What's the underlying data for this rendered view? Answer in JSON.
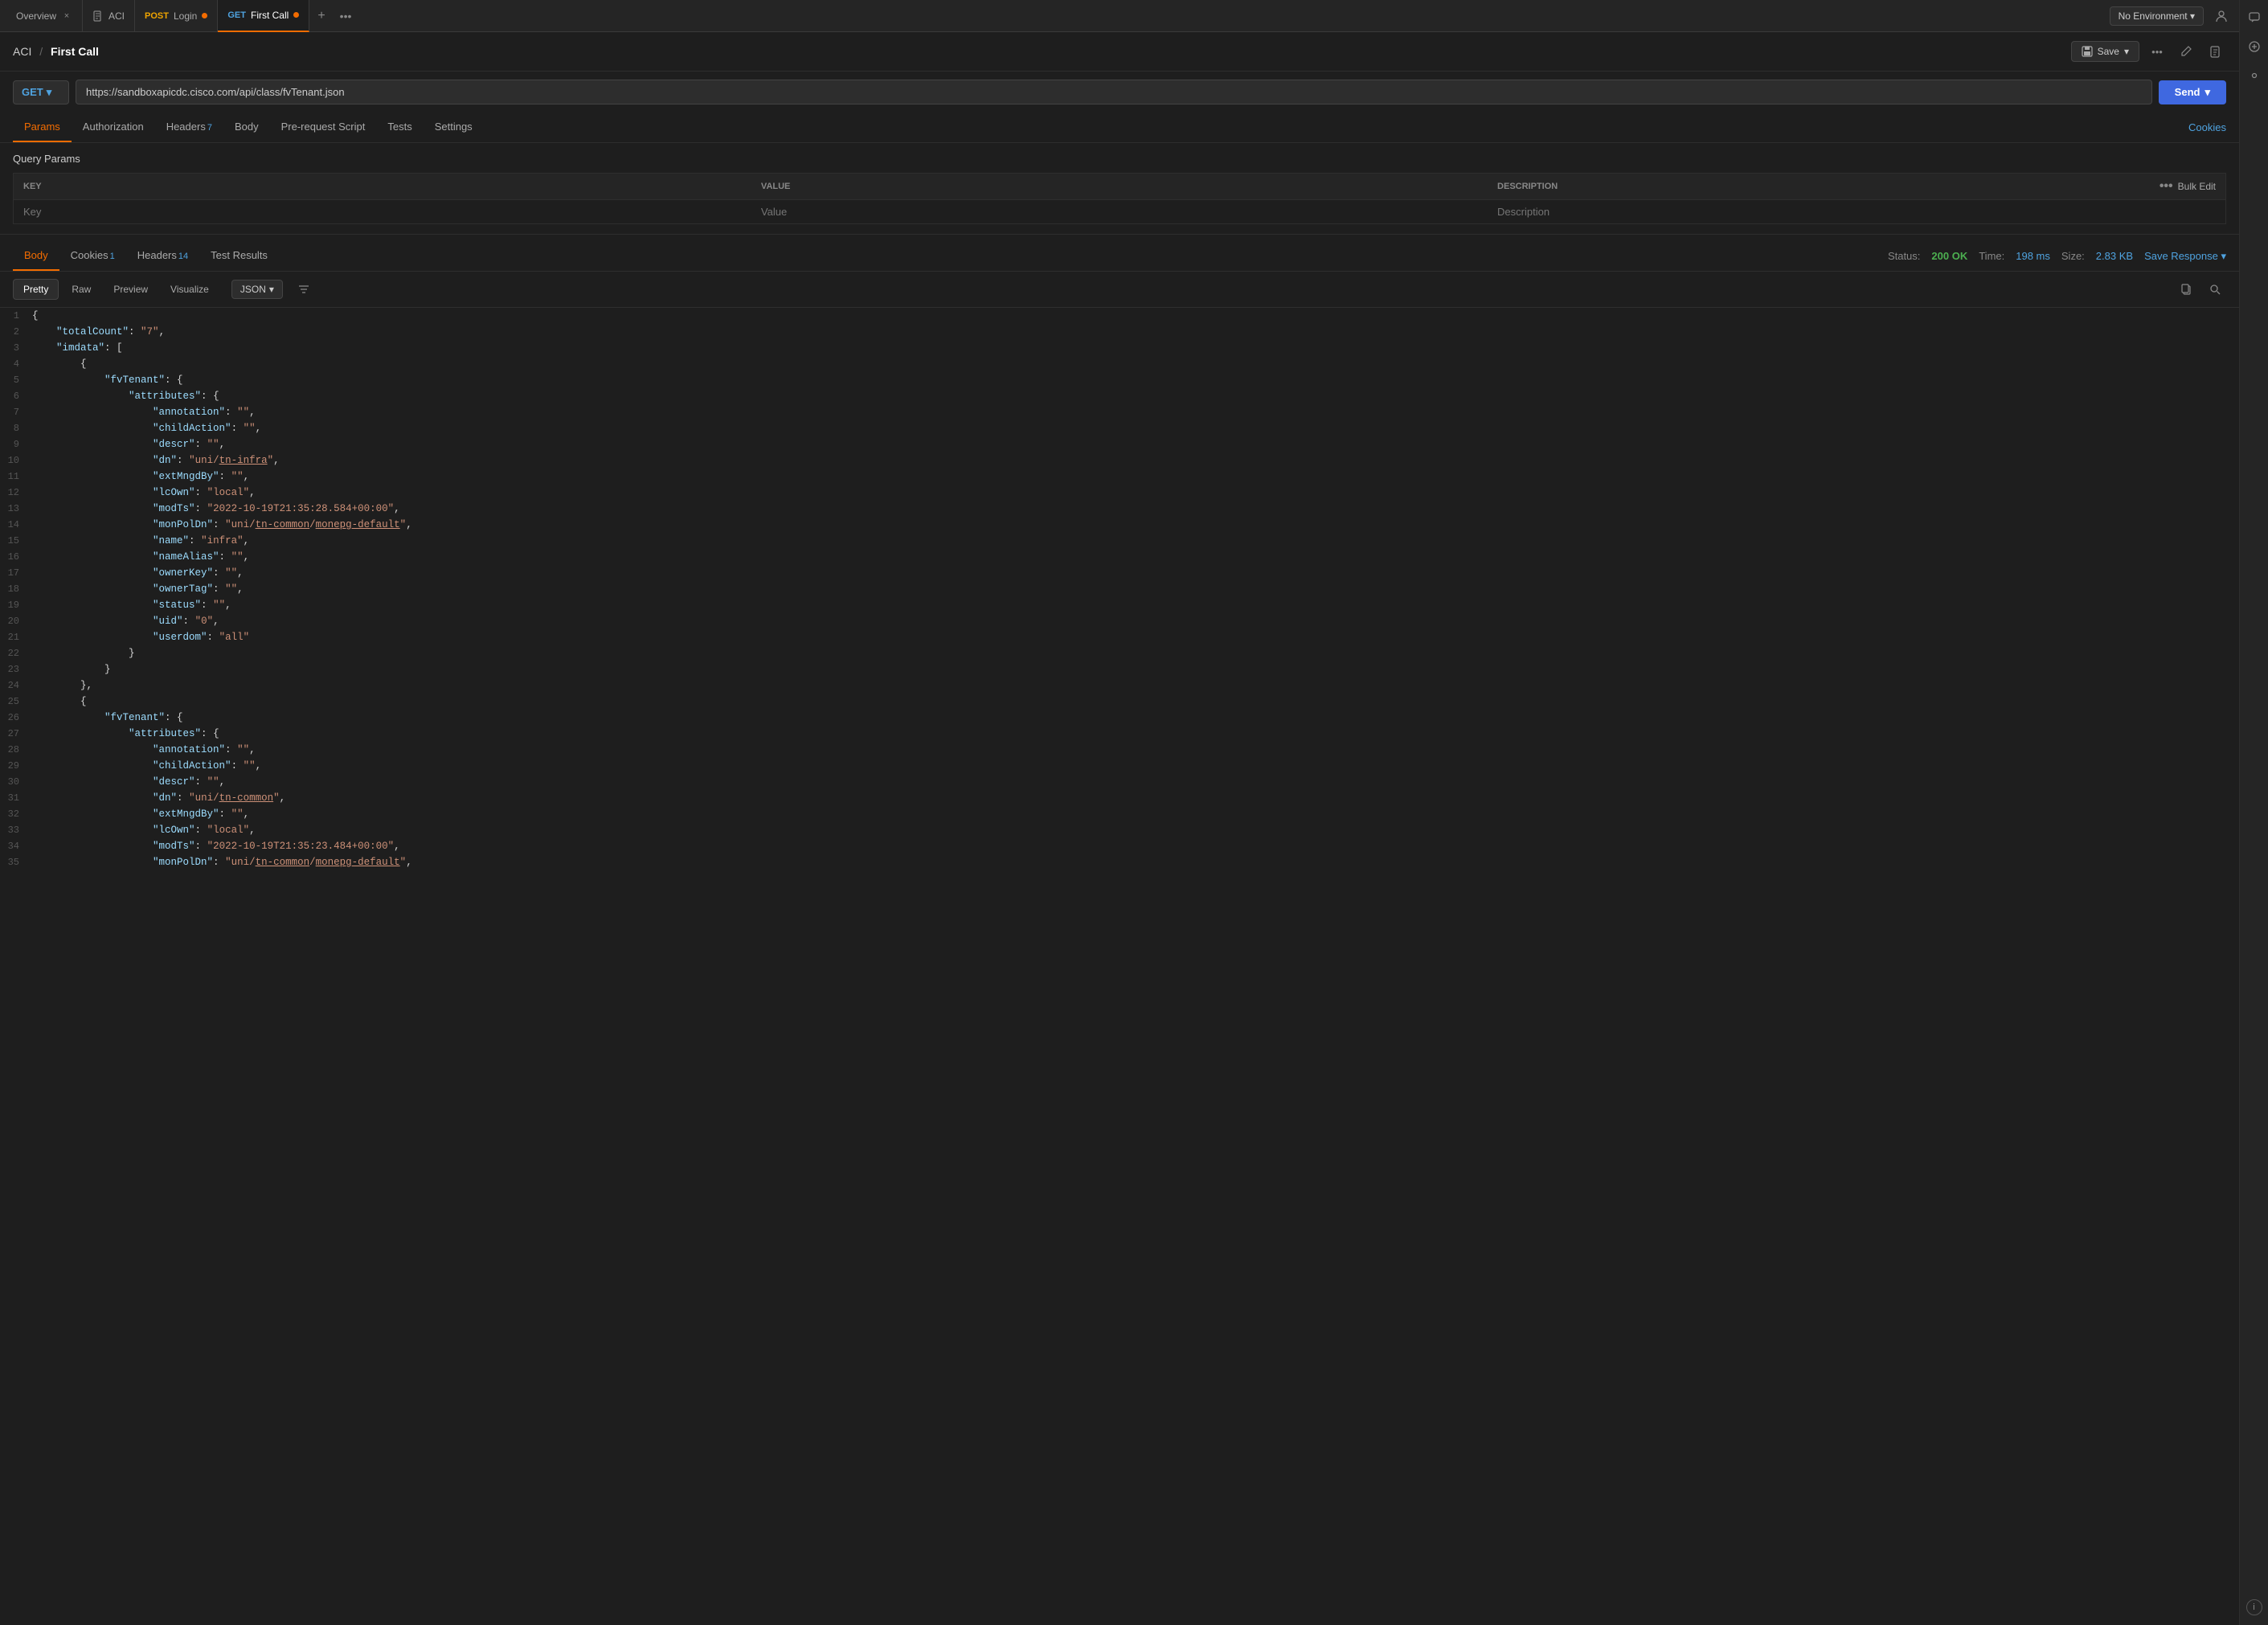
{
  "tabs": [
    {
      "id": "overview",
      "label": "Overview",
      "closable": true,
      "method": null,
      "dot": false
    },
    {
      "id": "aci",
      "label": "ACI",
      "closable": false,
      "method": null,
      "dot": false
    },
    {
      "id": "post-login",
      "label": "Login",
      "closable": false,
      "method": "POST",
      "dot": false
    },
    {
      "id": "get-first-call",
      "label": "First Call",
      "closable": false,
      "method": "GET",
      "dot": true,
      "active": true
    }
  ],
  "environment": {
    "label": "No Environment",
    "chevron": "▾"
  },
  "breadcrumb": {
    "parent": "ACI",
    "separator": "/",
    "current": "First Call"
  },
  "toolbar": {
    "save_label": "Save",
    "more_label": "•••"
  },
  "request": {
    "method": "GET",
    "url": "https://sandboxapicdc.cisco.com/api/class/fvTenant.json",
    "send_label": "Send"
  },
  "req_tabs": [
    {
      "id": "params",
      "label": "Params",
      "active": true,
      "badge": null
    },
    {
      "id": "authorization",
      "label": "Authorization",
      "active": false,
      "badge": null
    },
    {
      "id": "headers",
      "label": "Headers",
      "active": false,
      "badge": "7"
    },
    {
      "id": "body",
      "label": "Body",
      "active": false,
      "badge": null
    },
    {
      "id": "pre-request-script",
      "label": "Pre-request Script",
      "active": false,
      "badge": null
    },
    {
      "id": "tests",
      "label": "Tests",
      "active": false,
      "badge": null
    },
    {
      "id": "settings",
      "label": "Settings",
      "active": false,
      "badge": null
    }
  ],
  "cookies_label": "Cookies",
  "params": {
    "title": "Query Params",
    "columns": [
      "KEY",
      "VALUE",
      "DESCRIPTION"
    ],
    "bulk_edit_label": "Bulk Edit",
    "placeholder_key": "Key",
    "placeholder_value": "Value",
    "placeholder_desc": "Description"
  },
  "resp_tabs": [
    {
      "id": "body",
      "label": "Body",
      "active": true,
      "badge": null
    },
    {
      "id": "cookies",
      "label": "Cookies",
      "active": false,
      "badge": "1"
    },
    {
      "id": "headers",
      "label": "Headers",
      "active": false,
      "badge": "14"
    },
    {
      "id": "test-results",
      "label": "Test Results",
      "active": false,
      "badge": null
    }
  ],
  "response": {
    "status_label": "Status:",
    "status_value": "200 OK",
    "time_label": "Time:",
    "time_value": "198 ms",
    "size_label": "Size:",
    "size_value": "2.83 KB",
    "save_response_label": "Save Response",
    "chevron": "▾"
  },
  "body_view_tabs": [
    {
      "id": "pretty",
      "label": "Pretty",
      "active": true
    },
    {
      "id": "raw",
      "label": "Raw",
      "active": false
    },
    {
      "id": "preview",
      "label": "Preview",
      "active": false
    },
    {
      "id": "visualize",
      "label": "Visualize",
      "active": false
    }
  ],
  "format": "JSON",
  "code_lines": [
    {
      "num": 1,
      "content": "{"
    },
    {
      "num": 2,
      "content": "    \"totalCount\": \"7\","
    },
    {
      "num": 3,
      "content": "    \"imdata\": ["
    },
    {
      "num": 4,
      "content": "        {"
    },
    {
      "num": 5,
      "content": "            \"fvTenant\": {"
    },
    {
      "num": 6,
      "content": "                \"attributes\": {"
    },
    {
      "num": 7,
      "content": "                    \"annotation\": \"\","
    },
    {
      "num": 8,
      "content": "                    \"childAction\": \"\","
    },
    {
      "num": 9,
      "content": "                    \"descr\": \"\","
    },
    {
      "num": 10,
      "content": "                    \"dn\": \"uni/tn-infra\","
    },
    {
      "num": 11,
      "content": "                    \"extMngdBy\": \"\","
    },
    {
      "num": 12,
      "content": "                    \"lcOwn\": \"local\","
    },
    {
      "num": 13,
      "content": "                    \"modTs\": \"2022-10-19T21:35:28.584+00:00\","
    },
    {
      "num": 14,
      "content": "                    \"monPolDn\": \"uni/tn-common/monepg-default\","
    },
    {
      "num": 15,
      "content": "                    \"name\": \"infra\","
    },
    {
      "num": 16,
      "content": "                    \"nameAlias\": \"\","
    },
    {
      "num": 17,
      "content": "                    \"ownerKey\": \"\","
    },
    {
      "num": 18,
      "content": "                    \"ownerTag\": \"\","
    },
    {
      "num": 19,
      "content": "                    \"status\": \"\","
    },
    {
      "num": 20,
      "content": "                    \"uid\": \"0\","
    },
    {
      "num": 21,
      "content": "                    \"userdom\": \"all\""
    },
    {
      "num": 22,
      "content": "                }"
    },
    {
      "num": 23,
      "content": "            }"
    },
    {
      "num": 24,
      "content": "        },"
    },
    {
      "num": 25,
      "content": "        {"
    },
    {
      "num": 26,
      "content": "            \"fvTenant\": {"
    },
    {
      "num": 27,
      "content": "                \"attributes\": {"
    },
    {
      "num": 28,
      "content": "                    \"annotation\": \"\","
    },
    {
      "num": 29,
      "content": "                    \"childAction\": \"\","
    },
    {
      "num": 30,
      "content": "                    \"descr\": \"\","
    },
    {
      "num": 31,
      "content": "                    \"dn\": \"uni/tn-common\","
    },
    {
      "num": 32,
      "content": "                    \"extMngdBy\": \"\","
    },
    {
      "num": 33,
      "content": "                    \"lcOwn\": \"local\","
    },
    {
      "num": 34,
      "content": "                    \"modTs\": \"2022-10-19T21:35:23.484+00:00\","
    },
    {
      "num": 35,
      "content": "                    \"monPolDn\": \"uni/tn-common/monepg-default\","
    }
  ],
  "icons": {
    "close": "×",
    "add": "+",
    "more": "•••",
    "chevron_down": "▾",
    "save": "💾",
    "send_down": "▾",
    "search": "🔍",
    "copy": "⧉",
    "filter": "⇅",
    "earth": "🌐",
    "code": "</>",
    "info": "i"
  }
}
